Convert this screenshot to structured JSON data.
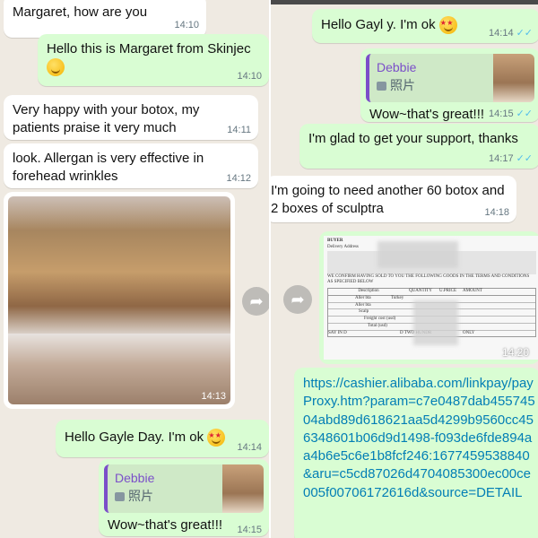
{
  "left": {
    "messages": [
      {
        "text": "Margaret, how are you",
        "time": "14:10"
      },
      {
        "text": "Hello this is Margaret from Skinjec",
        "time": "14:10"
      },
      {
        "text": "Very happy with your botox, my patients praise it very much",
        "time": "14:11"
      },
      {
        "text": "look. Allergan is very effective in forehead wrinkles",
        "time": "14:12"
      },
      {
        "time": "14:13"
      },
      {
        "text": "Hello Gayle Day. I'm ok",
        "time": "14:14"
      },
      {
        "reply_name": "Debbie",
        "reply_sub": "照片",
        "text": "Wow~that's great!!!",
        "time": "14:15"
      }
    ]
  },
  "right": {
    "messages": [
      {
        "text": "Hello Gayl      y. I'm ok",
        "time": "14:14"
      },
      {
        "reply_name": "Debbie",
        "reply_sub": "照片",
        "text": "Wow~that's great!!!",
        "time": "14:15"
      },
      {
        "text": "I'm glad to get your support, thanks",
        "time": "14:17"
      },
      {
        "text": "I'm going to need another 60 botox and 2 boxes of sculptra",
        "time": "14:18"
      },
      {
        "time": "14:20",
        "doc_lines": [
          "BUYER",
          "Delivery Address",
          "WE CONFIRM HAVING SOLD TO YOU THE FOLLOWING GOODS IN THE TERMS AND CONDITIONS",
          "AS SPECIFIED BELOW",
          "Description",
          "QUANTITY",
          "U.PRICE",
          "AMOUNT",
          "Aller bta",
          "Turkey",
          "Scalp",
          "Freight cost (usd)",
          "Total (usd)",
          "SAY IN D",
          "D TWO HUNDR",
          "ONLY"
        ]
      },
      {
        "text": "https://cashier.alibaba.com/linkpay/payProxy.htm?param=c7e0487dab45574504abd89d618621aa5d4299b9560cc456348601b06d9d1498-f093de6fde894aa4b6e5c6e1b8fcf246:1677459538840&aru=c5cd87026d4704085300ec00ce005f00706172616d&source=DETAIL"
      }
    ]
  }
}
